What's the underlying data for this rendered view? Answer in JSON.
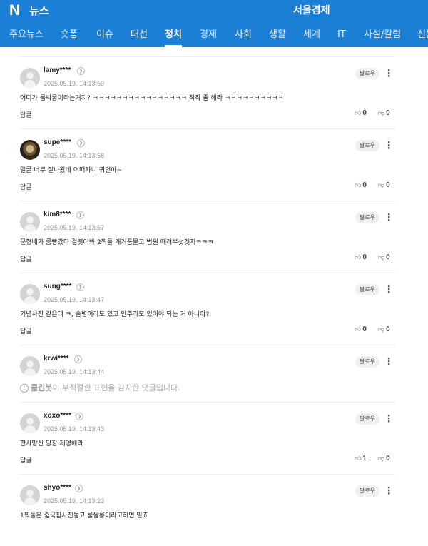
{
  "header": {
    "logo": "N",
    "service": "뉴스",
    "press": "서울경제"
  },
  "nav": {
    "tabs": [
      "주요뉴스",
      "숏폼",
      "이슈",
      "대선",
      "정치",
      "경제",
      "사회",
      "생활",
      "세계",
      "IT",
      "사설/칼럼",
      "신문보기"
    ],
    "active": "정치"
  },
  "labels": {
    "follow": "팔로우",
    "reply": "답글"
  },
  "comments": [
    {
      "user": "lamy****",
      "time": "2025.05.19. 14:13:59",
      "text": "어디가 룸싸롱이라는거지? ㅋㅋㅋㅋㅋㅋㅋㅋㅋㅋㅋㅋㅋㅋㅋㅋ 작작 좀 해라 ㅋㅋㅋㅋㅋㅋㅋㅋㅋㅋ",
      "likes": "0",
      "dislikes": "0"
    },
    {
      "user": "supe****",
      "time": "2025.05.19. 14:13:58",
      "text": "얼굴 너무 잘나왔네 어떠카니 귀연아~",
      "likes": "0",
      "dislikes": "0"
    },
    {
      "user": "kim8****",
      "time": "2025.05.19. 14:13:57",
      "text": "문형배가 룸빵갔다 걸렷어봐 2찍들 개거품물고 법원 때려부섯겟지ㅋㅋㅋ",
      "likes": "0",
      "dislikes": "0"
    },
    {
      "user": "sung****",
      "time": "2025.05.19. 14:13:47",
      "text": "기념사진 같은데 ㅋ, 술병이라도 있고 안주라도 있어야 되는 거 아니야?",
      "likes": "0",
      "dislikes": "0"
    },
    {
      "user": "krwi****",
      "time": "2025.05.19. 14:13:44",
      "cleanbot_name": "클린봇",
      "cleanbot_text": "이 부적절한 표현을 감지한 댓글입니다."
    },
    {
      "user": "xoxo****",
      "time": "2025.05.19. 14:13:43",
      "text": "판사망신 당장 제명해라",
      "likes": "1",
      "dislikes": "0"
    },
    {
      "user": "shyo****",
      "time": "2025.05.19. 14:13:23",
      "text": "1찍들은 중국집사진놓고 룸쌀롱이라고하면 믿죠"
    }
  ],
  "icons": {
    "logo": "naver-logo",
    "more": "more-vertical-icon",
    "like": "thumbs-up-icon",
    "dislike": "thumbs-down-icon",
    "profile": "chevron-right-icon",
    "cleanbot": "info-icon"
  },
  "colors": {
    "brand": "#1c7fd6"
  }
}
